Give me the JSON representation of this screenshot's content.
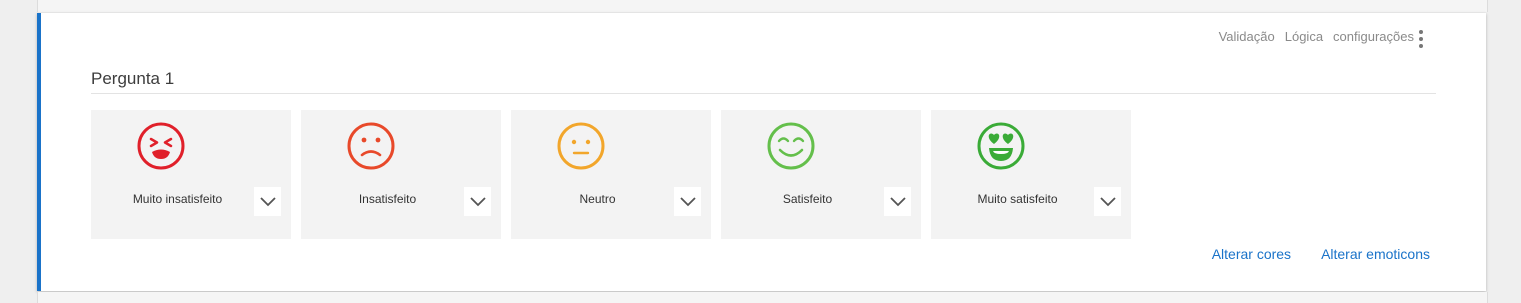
{
  "toolbar": {
    "validation": "Validação",
    "logic": "Lógica",
    "settings": "configurações"
  },
  "question": {
    "title": "Pergunta 1"
  },
  "options": [
    {
      "label": "Muito insatisfeito",
      "icon": "very-dissatisfied-icon",
      "color": "#e0202a"
    },
    {
      "label": "Insatisfeito",
      "icon": "dissatisfied-icon",
      "color": "#e8492a"
    },
    {
      "label": "Neutro",
      "icon": "neutral-icon",
      "color": "#f2a62b"
    },
    {
      "label": "Satisfeito",
      "icon": "satisfied-icon",
      "color": "#64bf4b"
    },
    {
      "label": "Muito satisfeito",
      "icon": "very-satisfied-icon",
      "color": "#3aab37"
    }
  ],
  "actions": {
    "change_colors": "Alterar cores",
    "change_emoticons": "Alterar emoticons"
  },
  "colors": {
    "accent": "#1a73c9"
  }
}
